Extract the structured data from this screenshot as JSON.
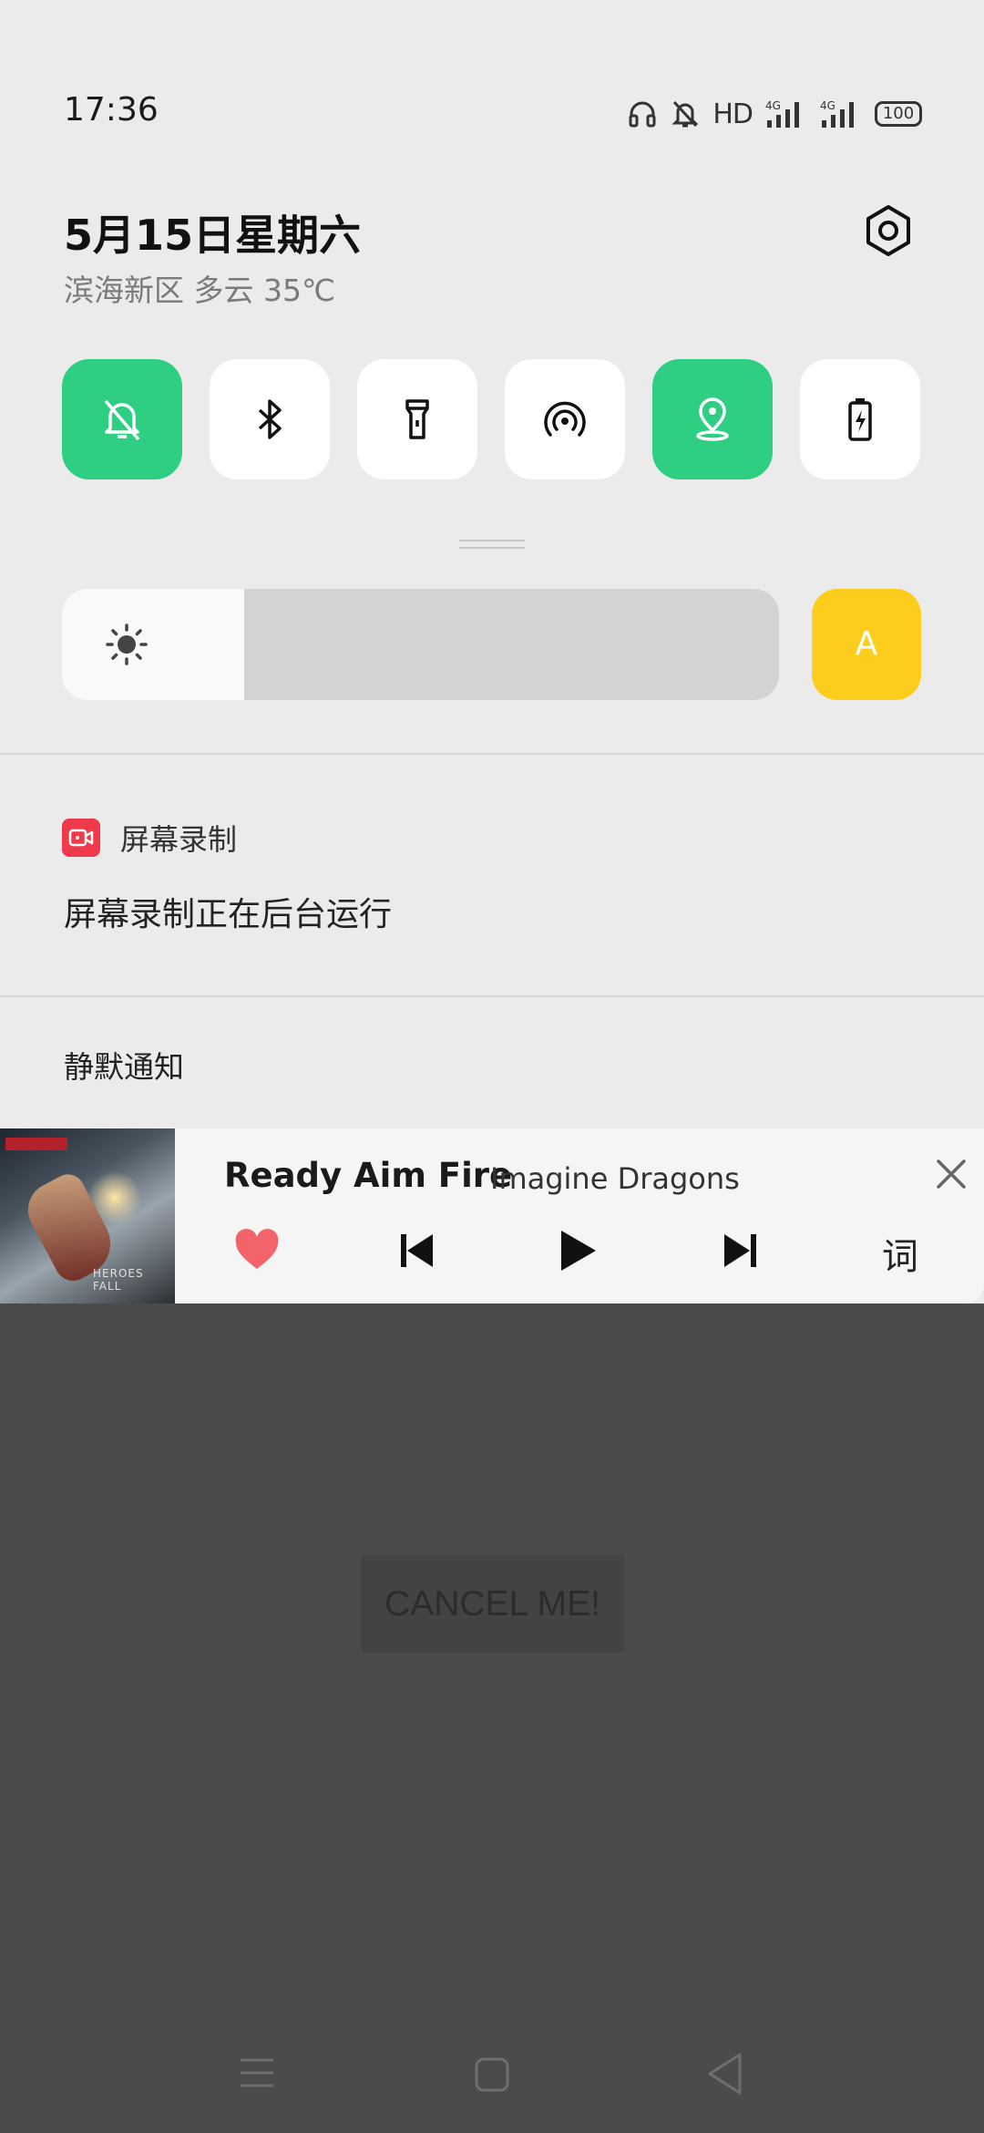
{
  "status_bar": {
    "time": "17:36",
    "hd": "HD",
    "network_1": "4G",
    "network_2": "4G",
    "battery": "100",
    "icons": [
      "headphones-icon",
      "mute-bell-icon",
      "signal-icon",
      "signal-icon",
      "battery-icon"
    ]
  },
  "header": {
    "date": "5月15日",
    "weekday": "星期六",
    "weather": "滨海新区 多云 35℃"
  },
  "quick_tiles": [
    {
      "icon": "silent-bell-icon",
      "active": true
    },
    {
      "icon": "bluetooth-icon",
      "active": false
    },
    {
      "icon": "flashlight-icon",
      "active": false
    },
    {
      "icon": "hotspot-icon",
      "active": false
    },
    {
      "icon": "location-icon",
      "active": true
    },
    {
      "icon": "battery-saver-icon",
      "active": false
    }
  ],
  "brightness": {
    "level_fraction": 0.254,
    "auto_label": "A"
  },
  "notification": {
    "app_name": "屏幕录制",
    "body": "屏幕录制正在后台运行"
  },
  "silent_section": {
    "label": "静默通知"
  },
  "music": {
    "title": "Ready Aim Fire",
    "artist": "Imagine Dragons",
    "lyrics_label": "词",
    "album_caption": "HEROES FALL",
    "liked": true
  },
  "background_app": {
    "button_label": "CANCEL ME!"
  },
  "colors": {
    "accent_green": "#2fcf83",
    "auto_yellow": "#fdcd1e",
    "record_red": "#ee3a4a",
    "heart_red": "#f2646a"
  }
}
